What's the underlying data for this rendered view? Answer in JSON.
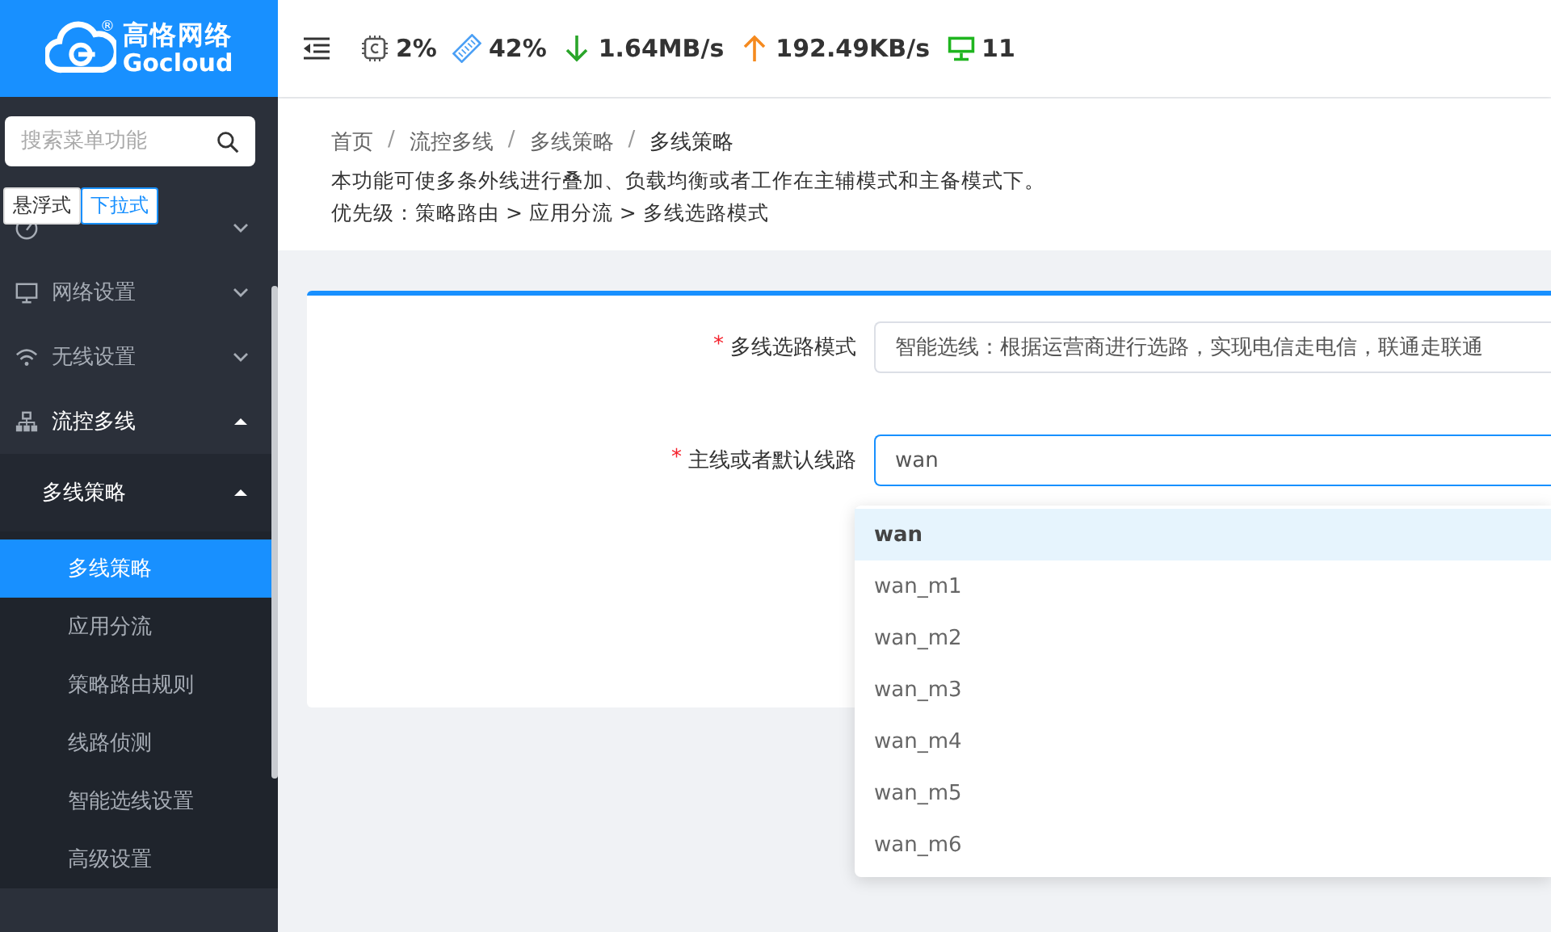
{
  "logo": {
    "name": "高恪网络",
    "sub": "Gocloud",
    "mark": "®"
  },
  "stats": [
    {
      "kind": "cpu",
      "value": "2%"
    },
    {
      "kind": "ram",
      "value": "42%"
    },
    {
      "kind": "down",
      "value": "1.64MB/s"
    },
    {
      "kind": "up",
      "value": "192.49KB/s"
    },
    {
      "kind": "clients",
      "value": "11"
    }
  ],
  "sidebar": {
    "search": {
      "placeholder": "搜索菜单功能"
    },
    "modes": [
      {
        "label": "悬浮式",
        "selected": false
      },
      {
        "label": "下拉式",
        "selected": true
      }
    ],
    "items": [
      {
        "expanded": false
      },
      {
        "label": "网络设置",
        "expanded": false
      },
      {
        "label": "无线设置",
        "expanded": false
      },
      {
        "label": "流控多线",
        "expanded": true,
        "children": [
          {
            "label": "多线策略",
            "expanded": true,
            "children": [
              {
                "label": "多线策略",
                "selected": true
              },
              {
                "label": "应用分流",
                "selected": false
              },
              {
                "label": "策略路由规则",
                "selected": false
              },
              {
                "label": "线路侦测",
                "selected": false
              },
              {
                "label": "智能选线设置",
                "selected": false
              },
              {
                "label": "高级设置",
                "selected": false
              }
            ]
          }
        ]
      }
    ]
  },
  "breadcrumb": [
    {
      "label": "首页"
    },
    {
      "separator": "/",
      "label": "流控多线"
    },
    {
      "separator": "/",
      "label": "多线策略"
    },
    {
      "separator": "/",
      "label": "多线策略"
    }
  ],
  "description": [
    "本功能可使多条外线进行叠加、负载均衡或者工作在主辅模式和主备模式下。",
    "优先级：策略路由 > 应用分流 > 多线选路模式"
  ],
  "form": [
    {
      "marker": "*",
      "label": "多线选路模式",
      "value": "智能选线：根据运营商进行选路，实现电信走电信，联通走联通",
      "focused": false
    },
    {
      "marker": "*",
      "label": "主线或者默认线路",
      "value": "wan",
      "focused": true
    }
  ],
  "dropdown": [
    {
      "label": "wan",
      "selected": true
    },
    {
      "label": "wan_m1",
      "selected": false
    },
    {
      "label": "wan_m2",
      "selected": false
    },
    {
      "label": "wan_m3",
      "selected": false
    },
    {
      "label": "wan_m4",
      "selected": false
    },
    {
      "label": "wan_m5",
      "selected": false
    },
    {
      "label": "wan_m6",
      "selected": false
    }
  ]
}
